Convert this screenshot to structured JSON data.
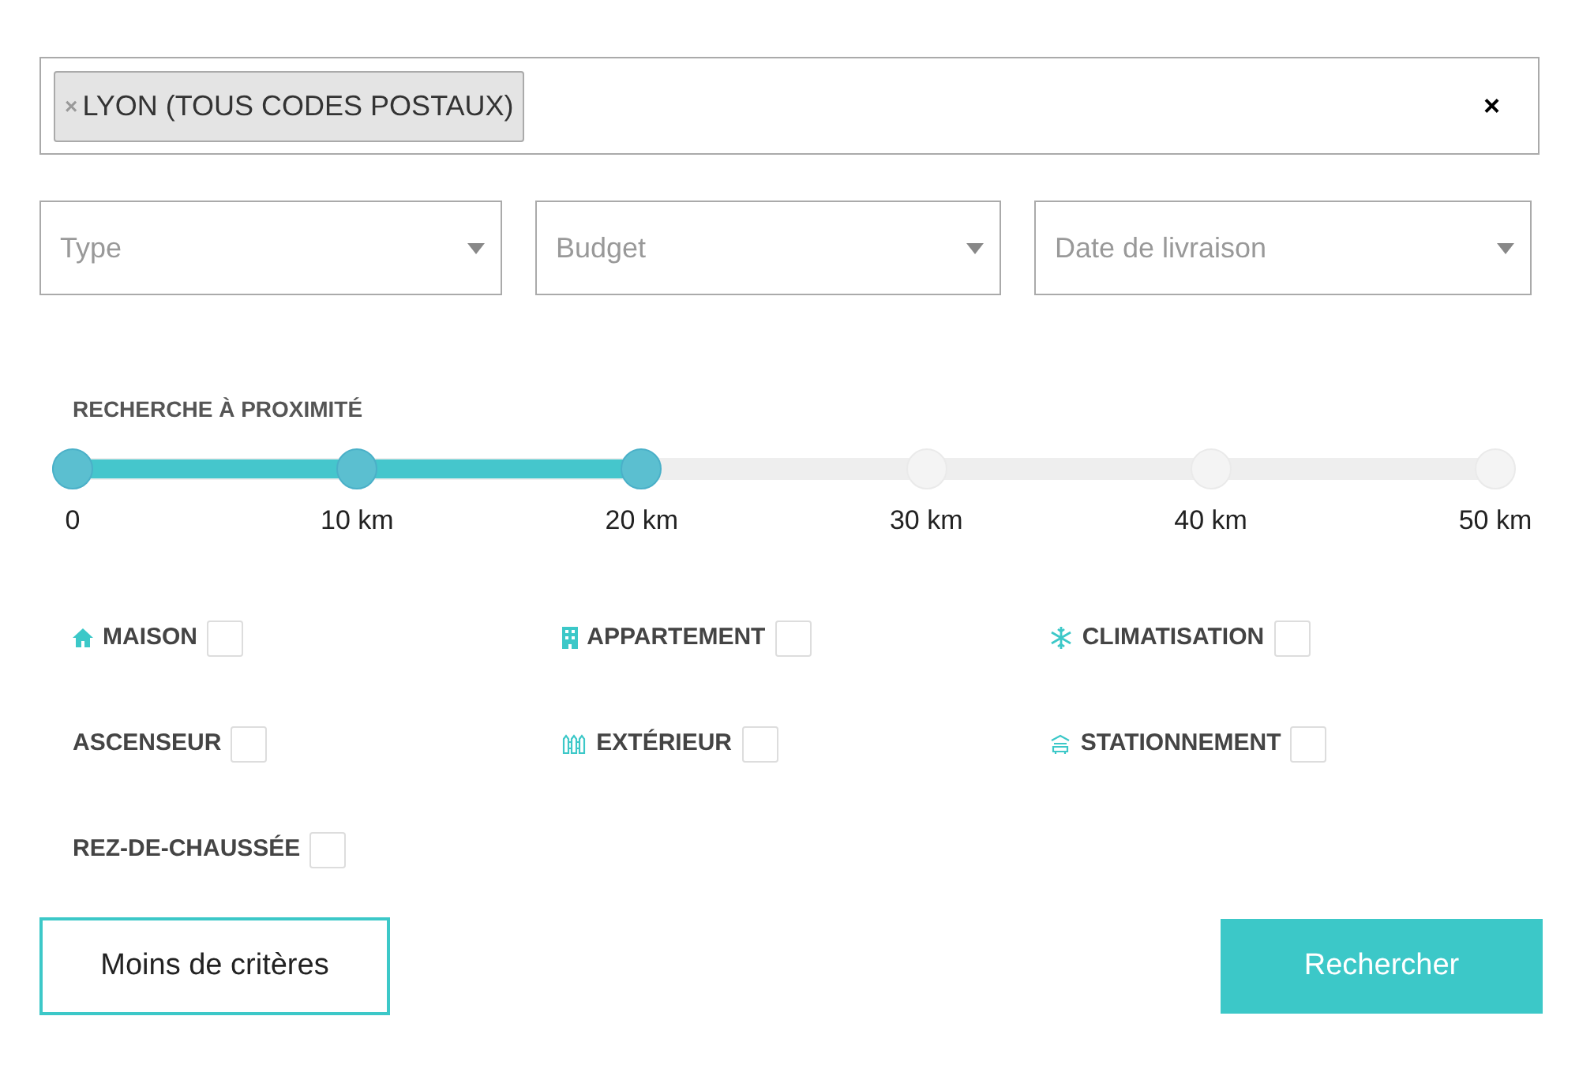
{
  "location": {
    "tags": [
      {
        "label": "LYON (TOUS CODES POSTAUX)",
        "remove": "×"
      }
    ],
    "clear": "×"
  },
  "selects": [
    {
      "placeholder": "Type"
    },
    {
      "placeholder": "Budget"
    },
    {
      "placeholder": "Date de livraison"
    }
  ],
  "proximity": {
    "title": "RECHERCHE À PROXIMITÉ",
    "level": 0.4,
    "stops": [
      "0",
      "10 km",
      "20 km",
      "30 km",
      "40 km",
      "50 km"
    ]
  },
  "features": [
    {
      "kind": "house",
      "label": "MAISON",
      "checked": false
    },
    {
      "kind": "building",
      "label": "APPARTEMENT",
      "checked": false
    },
    {
      "kind": "snowflake",
      "label": "CLIMATISATION",
      "checked": false
    },
    {
      "kind": "plain",
      "label": "ASCENSEUR",
      "checked": false
    },
    {
      "kind": "fence",
      "label": "EXTÉRIEUR",
      "checked": false
    },
    {
      "kind": "garage",
      "label": "STATIONNEMENT",
      "checked": false
    },
    {
      "kind": "plain",
      "label": "REZ-DE-CHAUSSÉE",
      "checked": false
    }
  ],
  "buttons": {
    "secondary": "Moins de critères",
    "primary": "Rechercher"
  }
}
